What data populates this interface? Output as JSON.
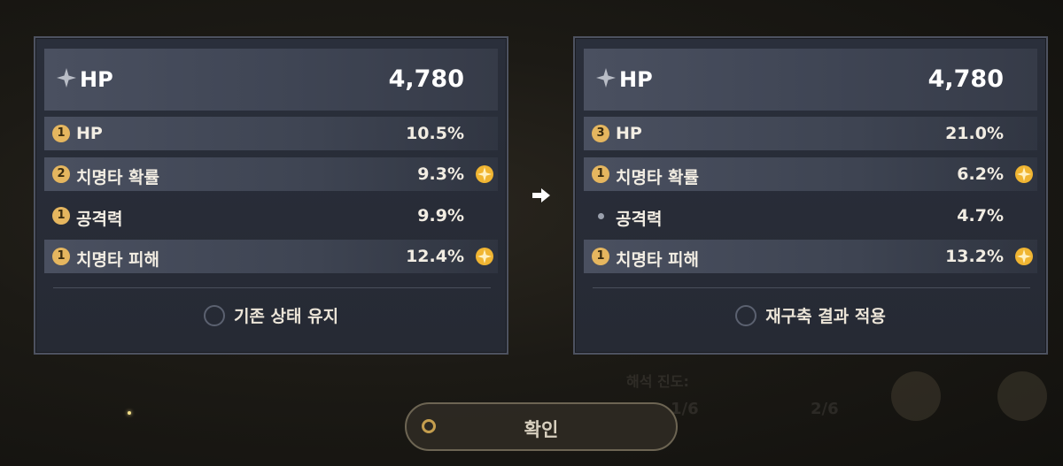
{
  "left_panel": {
    "main_stat": {
      "name": "HP",
      "value": "4,780"
    },
    "substats": [
      {
        "rolls": "1",
        "name": "HP",
        "value": "10.5%",
        "highlight": true,
        "marked": false
      },
      {
        "rolls": "2",
        "name": "치명타 확률",
        "value": "9.3%",
        "highlight": true,
        "marked": true
      },
      {
        "rolls": "1",
        "name": "공격력",
        "value": "9.9%",
        "highlight": false,
        "marked": false
      },
      {
        "rolls": "1",
        "name": "치명타 피해",
        "value": "12.4%",
        "highlight": true,
        "marked": true
      }
    ],
    "option_label": "기존 상태 유지"
  },
  "right_panel": {
    "main_stat": {
      "name": "HP",
      "value": "4,780"
    },
    "substats": [
      {
        "rolls": "3",
        "name": "HP",
        "value": "21.0%",
        "highlight": true,
        "marked": false
      },
      {
        "rolls": "1",
        "name": "치명타 확률",
        "value": "6.2%",
        "highlight": true,
        "marked": true
      },
      {
        "rolls": "",
        "name": "공격력",
        "value": "4.7%",
        "highlight": false,
        "marked": false
      },
      {
        "rolls": "1",
        "name": "치명타 피해",
        "value": "13.2%",
        "highlight": true,
        "marked": true
      }
    ],
    "option_label": "재구축 결과 적용"
  },
  "confirm_button": {
    "label": "확인"
  },
  "background": {
    "progress_label": "해석 진도:",
    "progress_a": "1/6",
    "progress_b": "2/6"
  },
  "colors": {
    "badge": "#e5b65f",
    "panel": "#2a2f3b",
    "accent_gold": "#f0b532"
  },
  "icons": {
    "main_stat": "four-point-star-icon",
    "marked": "gold-sparkle-icon",
    "transition": "right-arrow-icon"
  }
}
